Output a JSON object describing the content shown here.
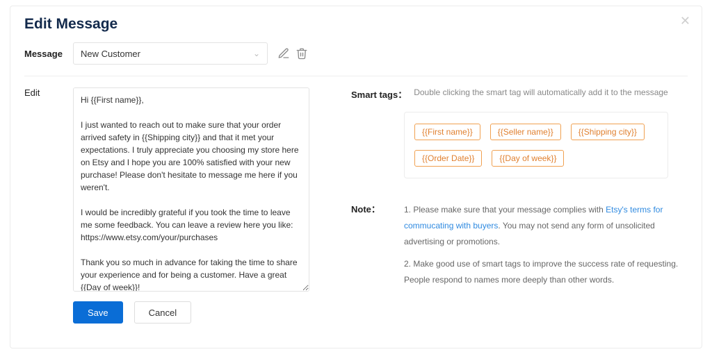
{
  "title": "Edit Message",
  "labels": {
    "message": "Message",
    "edit": "Edit",
    "smart_tags": "Smart tags：",
    "note": "Note："
  },
  "select": {
    "value": "New Customer"
  },
  "editor": {
    "value": "Hi {{First name}},\n\nI just wanted to reach out to make sure that your order arrived safety in {{Shipping city}} and that it met your expectations. I truly appreciate you choosing my store here on Etsy and I hope you are 100% satisfied with your new purchase! Please don't hesitate to message me here if you weren't.\n\nI would be incredibly grateful if you took the time to leave me some feedback. You can leave a review here you like: https://www.etsy.com/your/purchases\n\nThank you so much in advance for taking the time to share your experience and for being a customer. Have a great {{Day of week}}!\n\nKind Regrads,\n{{Seller name}}"
  },
  "buttons": {
    "save": "Save",
    "cancel": "Cancel"
  },
  "smart": {
    "hint": "Double clicking the smart tag will automatically add it to the message",
    "tags": {
      "t1": "{{First name}}",
      "t2": "{{Seller name}}",
      "t3": "{{Shipping city}}",
      "t4": "{{Order Date}}",
      "t5": "{{Day of week}}"
    }
  },
  "note": {
    "p1a": "1. Please make sure that your message complies with ",
    "p1link": "Etsy's terms for commucating with buyers",
    "p1b": ". You may not send any form of unsolicited advertising or promotions.",
    "p2": "2. Make good use of smart tags to improve the success rate of requesting. People respond to names more deeply than other words."
  }
}
